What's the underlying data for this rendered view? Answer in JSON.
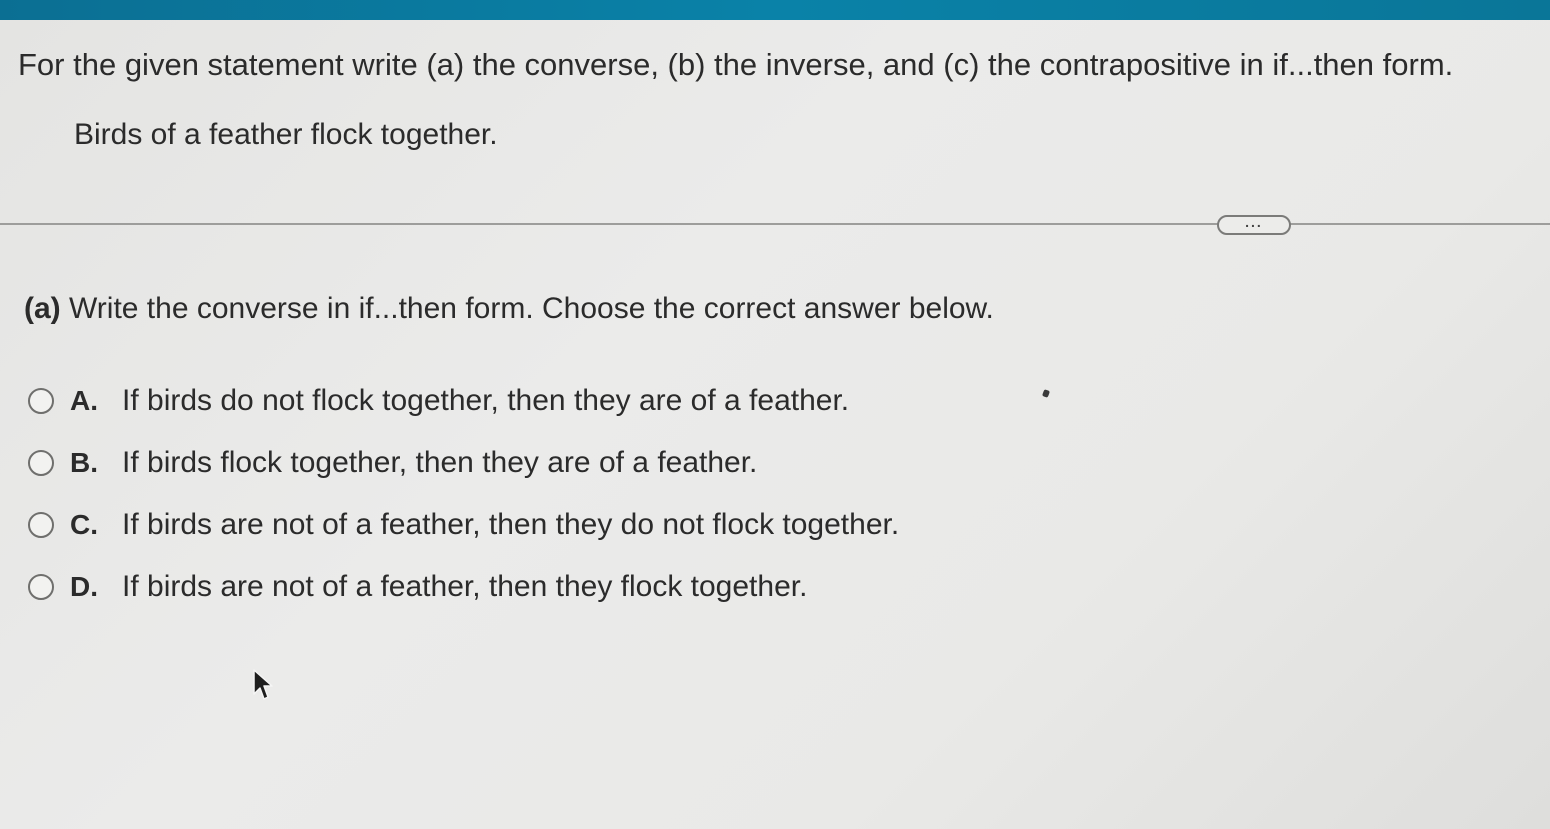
{
  "question": {
    "instruction": "For the given statement write (a) the converse, (b) the inverse, and (c) the contrapositive in if...then form.",
    "statement": "Birds of a feather flock together."
  },
  "toolbar": {
    "more_label": "..."
  },
  "part_a": {
    "label": "(a)",
    "prompt": "Write the converse in if...then form. Choose the correct answer below.",
    "options": [
      {
        "letter": "A.",
        "text": "If birds do not flock together, then they are of a feather."
      },
      {
        "letter": "B.",
        "text": "If birds flock together, then they are of a feather."
      },
      {
        "letter": "C.",
        "text": "If birds are not of a feather, then they do not flock together."
      },
      {
        "letter": "D.",
        "text": "If birds are not of a feather, then they flock together."
      }
    ]
  },
  "colors": {
    "header_bar": "#0a7fa3",
    "background": "#e8e8e6",
    "text": "#2b2b2b"
  },
  "icons": {
    "cursor": "mouse-pointer-icon",
    "more": "ellipsis-icon"
  }
}
